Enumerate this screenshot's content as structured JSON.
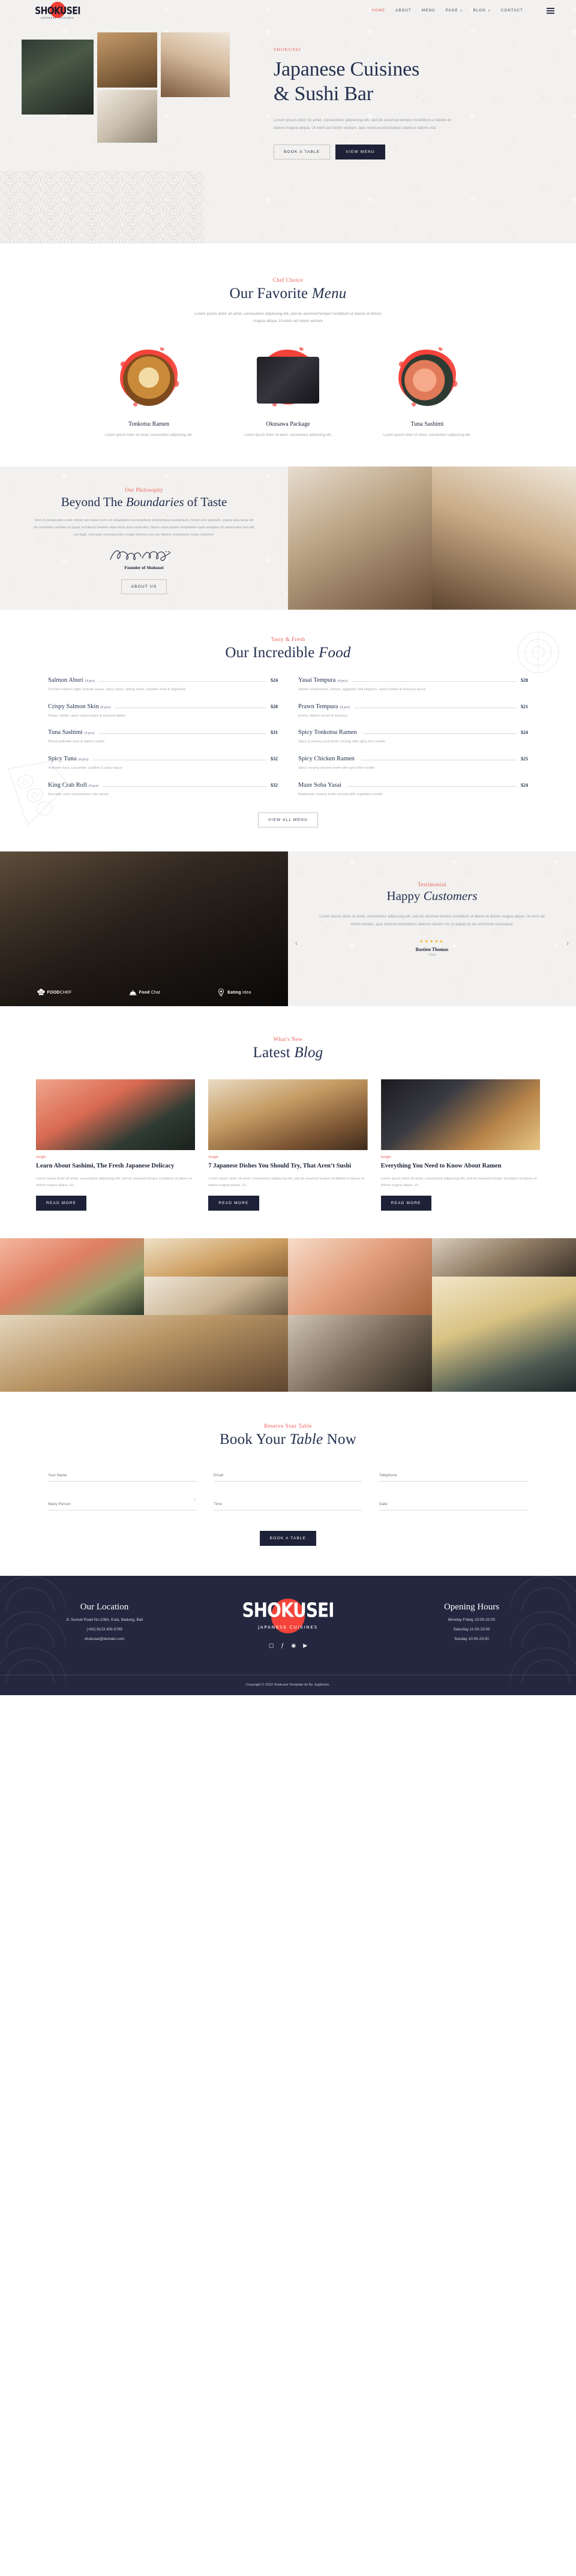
{
  "brand": {
    "name": "SHOKUSEI",
    "tagline": "JAPANESE CUISINES",
    "accent": "#ea5a52",
    "dark": "#232840"
  },
  "nav": {
    "items": [
      {
        "label": "HOME",
        "active": true,
        "caret": ""
      },
      {
        "label": "ABOUT",
        "active": false,
        "caret": ""
      },
      {
        "label": "MENU",
        "active": false,
        "caret": ""
      },
      {
        "label": "PAGE",
        "active": false,
        "caret": "∨"
      },
      {
        "label": "BLOG",
        "active": false,
        "caret": "∨"
      },
      {
        "label": "CONTACT",
        "active": false,
        "caret": ""
      }
    ]
  },
  "hero": {
    "eyebrow": "SHOKUSEI",
    "title_line1": "Japanese Cuisines",
    "title_line2": "& Sushi Bar",
    "paragraph": "Lorem ipsum dolor sit amet, consectetur adipiscing elit, sed do eiusmod tempor incididunt ut labore et dolore magna aliqua. Ut enim ad minim veniam, quis nostrud exercitation ullamco laboris nisi",
    "btn_primary": "BOOK A TABLE",
    "btn_secondary": "VIEW MENU"
  },
  "favorite": {
    "eyebrow": "Chef Choice",
    "title_a": "Our Favorite ",
    "title_i": "Menu",
    "subtitle": "Lorem ipsum dolor sit amet, consectetur adipiscing elit, sed do eiusmod tempor incididunt ut labore et dolore magna aliqua. Ut enim ad minim veniam",
    "cards": [
      {
        "name": "Tonkotsu Ramen",
        "desc": "Lorem ipsum dolor sit amet, consectetur adipiscing elit."
      },
      {
        "name": "Okusawa Package",
        "desc": "Lorem ipsum dolor sit amet, consectetur adipiscing elit."
      },
      {
        "name": "Tuna Sashimi",
        "desc": "Lorem ipsum dolor sit amet, consectetur adipiscing elit."
      }
    ]
  },
  "philosophy": {
    "eyebrow": "Our Philosophy",
    "title_a": "Beyond The ",
    "title_i": "Boundaries",
    "title_b": " of Taste",
    "paragraph": "Sed ut perspiciatis unde omnis iste natus error sit voluptatem accusantium doloremque laudantium, totam rem aperiam, eaque ipsa quae ab illo inventore veritatis et quasi architecto beatae vitae dicta sunt explicabo. Nemo enim ipsam voluptatem quia voluptas sit aspernatur aut odit aut fugit, sed quia consequuntur magni dolores eos qui ratione voluptatem sequi nesciunt.",
    "signature_name": "Konoshi Shoji",
    "role": "Founder of Shokusei",
    "button": "ABOUT US"
  },
  "food": {
    "eyebrow": "Tasty & Fresh",
    "title_a": "Our Incredible ",
    "title_i": "Food",
    "button": "VIEW ALL MENU",
    "left": [
      {
        "name": "Salmon Aburi",
        "pcs": "(4 pcs)",
        "price": "$24",
        "desc": "Torched salmon nigiri, teriyaki sauce, spicy mayo, spring onion, sesame seed & togarashi"
      },
      {
        "name": "Crispy Salmon Skin",
        "pcs": "(6 pcs)",
        "price": "$28",
        "desc": "Prawn, tobiko, spicy mayonnaise & tempura flakes"
      },
      {
        "name": "Tuna Sashimi",
        "pcs": "(4 pcs)",
        "price": "$31",
        "desc": "Sliced yellowfin tuna & daikon radish"
      },
      {
        "name": "Spicy Tuna",
        "pcs": "(6 pcs)",
        "price": "$32",
        "desc": "Yellowfin tuna, cucumber, scallion & spicy sauce"
      },
      {
        "name": "King Crab Roll",
        "pcs": "(4 pcs)",
        "price": "$32",
        "desc": "Avocado, yuzu mayonnaise, mix sprout"
      }
    ],
    "right": [
      {
        "name": "Yasai Tempura",
        "pcs": "(4 pcs)",
        "price": "$28",
        "desc": "shitake mushrooms, onions, eggplant, bell peppers, sweet potato & tentsuyu sauce"
      },
      {
        "name": "Prawn Tempura",
        "pcs": "(4 pcs)",
        "price": "$21",
        "desc": "prawn, daikon oroshi & tentsuyu"
      },
      {
        "name": "Spicy Tonkotsu Ramen",
        "pcs": "",
        "price": "$24",
        "desc": "Spicy & creamy pork broth serving with spicy thin noodle"
      },
      {
        "name": "Spicy Chicken Ramen",
        "pcs": "",
        "price": "$25",
        "desc": "Spicy creamy chicken broth with spicy thin noodle"
      },
      {
        "name": "Maze Soba Yasai",
        "pcs": "",
        "price": "$24",
        "desc": "Mushroom creamy broth serving with vegetable noodle"
      }
    ]
  },
  "testimonial": {
    "eyebrow": "Testimonial",
    "title_a": "Happy ",
    "title_i": "Customers",
    "quote": "Lorem ipsum dolor sit amet, consectetur adipiscing elit, sed do eiusmod tempor incididunt ut labore et dolore magna aliqua. Ut enim ad minim veniam, quis nostrud exercitation ullamco laboris nisi ut aliquip ex ea commodo consequat.",
    "stars": "★★★★★",
    "rating": "4.5",
    "name": "Bastien Thomas",
    "role": "Chef",
    "prev": "‹",
    "next": "›",
    "brands": [
      {
        "text_bold": "FOOD",
        "text_light": "CHEF",
        "icon": "chef-hat-icon"
      },
      {
        "text_bold": "Food",
        "text_light": " Chat",
        "icon": "cloche-icon"
      },
      {
        "text_bold": "Eating",
        "text_light": " Idea",
        "icon": "bulb-heart-icon"
      }
    ]
  },
  "blog": {
    "eyebrow": "What's New",
    "title_a": "Latest ",
    "title_i": "Blog",
    "read_more": "READ MORE",
    "posts": [
      {
        "category": "Insight",
        "title": "Learn About Sashimi, The Fresh Japanese Delicacy",
        "excerpt": "Lorem ipsum dolor sit amet, consectetur adipiscing elit, sed do eiusmod tempor incididunt ut labore et dolore magna aliqua. Ut..."
      },
      {
        "category": "Insight",
        "title": "7 Japanese Dishes You Should Try, That Aren’t Sushi",
        "excerpt": "Lorem ipsum dolor sit amet, consectetur adipiscing elit, sed do eiusmod tempor incididunt ut labore et dolore magna aliqua. Ut..."
      },
      {
        "category": "Insight",
        "title": "Everything You Need to Know About Ramen",
        "excerpt": "Lorem ipsum dolor sit amet, consectetur adipiscing elit, sed do eiusmod tempor incididunt ut labore et dolore magna aliqua. Ut..."
      }
    ]
  },
  "booking": {
    "eyebrow": "Reserve Your Table",
    "title_a": "Book Your ",
    "title_i": "Table",
    "title_b": " Now",
    "fields": {
      "name": "Your Name",
      "email": "Email",
      "phone": "Telephone",
      "persons": "Many Person",
      "time": "Time",
      "date": "Date"
    },
    "button": "BOOK A TABLE"
  },
  "footer": {
    "location_heading": "Our Location",
    "address": "Jl. Sunset Road No.108A, Kuta, Badung, Bali",
    "phone": "(+62) 8123 456 6789",
    "email": "shokusei@domain.com",
    "hours_heading": "Opening Hours",
    "hours": [
      "Monday-Friday 10:00-22:00",
      "Saturday 11:00-23:00",
      "Sunday 10:30-23:00"
    ],
    "socials": [
      "instagram-icon",
      "facebook-icon",
      "tripadvisor-icon",
      "youtube-icon"
    ],
    "copyright": "Copyright © 2022 Shokusei Template kit By Jegtheme."
  }
}
